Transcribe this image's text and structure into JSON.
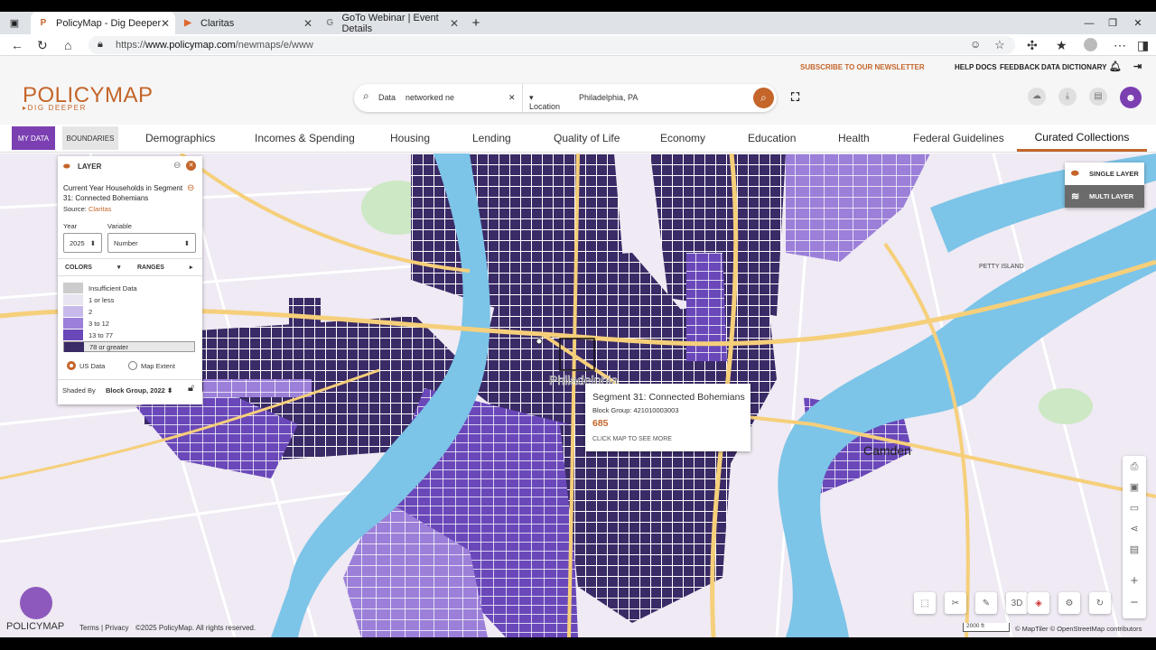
{
  "browser": {
    "tabs": [
      {
        "label": "PolicyMap - Dig Deeper",
        "active": true
      },
      {
        "label": "Claritas",
        "active": false
      },
      {
        "label": "GoTo Webinar | Event Details",
        "active": false
      }
    ],
    "url_prefix": "https://",
    "url_host": "www.policymap.com",
    "url_path": "/newmaps/e/www"
  },
  "header": {
    "logo_main": "POLICYMAP",
    "logo_tag": "DIG DEEPER",
    "newsletter": "SUBSCRIBE TO OUR NEWSLETTER",
    "help_docs": "HELP DOCS",
    "feedback": "FEEDBACK",
    "data_dictionary": "DATA DICTIONARY"
  },
  "search": {
    "data_label": "Data",
    "data_value": "networked ne",
    "location_label": "Location",
    "location_value": "Philadelphia, PA"
  },
  "nav": {
    "my_data": "MY DATA",
    "boundaries": "BOUNDARIES",
    "items": [
      "Demographics",
      "Incomes & Spending",
      "Housing",
      "Lending",
      "Quality of Life",
      "Economy",
      "Education",
      "Health",
      "Federal Guidelines",
      "Curated Collections"
    ],
    "active": "Curated Collections"
  },
  "layer_panel": {
    "header": "LAYER",
    "title": "Current Year Households in Segment 31: Connected Bohemians",
    "source_label": "Source:",
    "source_name": "Claritas",
    "year_label": "Year",
    "year_value": "2025",
    "variable_label": "Variable",
    "variable_value": "Number",
    "colors_label": "COLORS",
    "ranges_label": "RANGES",
    "legend": [
      {
        "label": "Insufficient Data",
        "color": "#cccccc"
      },
      {
        "label": "1 or less",
        "color": "#e8e4f0"
      },
      {
        "label": "2",
        "color": "#c7b9ea"
      },
      {
        "label": "3 to 12",
        "color": "#9b7fd8"
      },
      {
        "label": "13 to 77",
        "color": "#6a48b9"
      },
      {
        "label": "78 or greater",
        "color": "#3a2a66"
      }
    ],
    "radio_us": "US Data",
    "radio_extent": "Map Extent",
    "shaded_by_label": "Shaded By",
    "shaded_by_value": "Block Group, 2022"
  },
  "tooltip": {
    "title": "Segment 31: Connected Bohemians",
    "subtitle": "Block Group: 421010003003",
    "value": "685",
    "cta": "CLICK MAP TO SEE MORE"
  },
  "layer_toggle": {
    "single": "SINGLE LAYER",
    "multi": "MULTI LAYER"
  },
  "map_labels": {
    "city": "Philadelphia",
    "camden": "Camden",
    "petty_island": "PETTY ISLAND",
    "three_d": "3D",
    "scale": "2000 ft"
  },
  "footer": {
    "terms": "Terms | Privacy",
    "copyright": "©2025 PolicyMap. All rights reserved.",
    "attribution": "© MapTiler © OpenStreetMap contributors",
    "logo": "POLICYMAP"
  },
  "colors": {
    "brand_orange": "#c4652a",
    "brand_purple": "#7b3fb2",
    "water": "#7cc4e8",
    "roads": "#f6cf7a"
  }
}
